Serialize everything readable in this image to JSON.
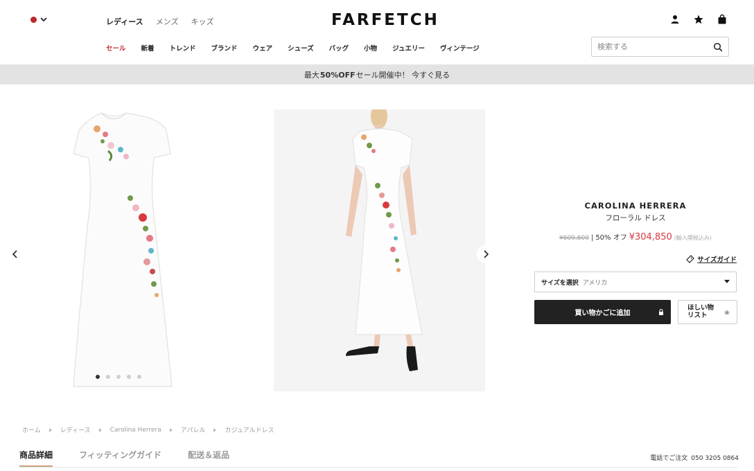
{
  "header": {
    "logo": "FARFETCH",
    "gender_nav": [
      "レディース",
      "メンズ",
      "キッズ"
    ],
    "category_nav": [
      "セール",
      "新着",
      "トレンド",
      "ブランド",
      "ウェア",
      "シューズ",
      "バッグ",
      "小物",
      "ジュエリー",
      "ヴィンテージ"
    ],
    "search_placeholder": "検索する"
  },
  "promo": {
    "prefix": "最大",
    "highlight": "50%OFF",
    "suffix": "セール開催中！ 今すぐ見る"
  },
  "product": {
    "brand": "CAROLINA HERRERA",
    "name": "フローラル ドレス",
    "old_price": "¥609,600",
    "discount": "50% オフ",
    "price": "¥304,850",
    "tax_note": "(輸入関税込み)",
    "size_guide": "サイズガイド",
    "size_label": "サイズを選択",
    "size_value": "アメリカ",
    "add_to_bag": "買い物かごに追加",
    "wishlist_line1": "ほしい物",
    "wishlist_line2": "リスト"
  },
  "breadcrumb": [
    "ホーム",
    "レディース",
    "Carolina Herrera",
    "アパレル",
    "カジュアルドレス"
  ],
  "tabs": [
    "商品詳細",
    "フィッティングガイド",
    "配送＆返品"
  ],
  "phone": {
    "label": "電話でご注文",
    "number": "050 3205 0864"
  },
  "colors": {
    "accent_sale": "#c2313b",
    "price_red": "#d2393f",
    "button_dark": "#222222",
    "promo_bg": "#e3e3e3",
    "tab_underline": "#c9a27b"
  }
}
